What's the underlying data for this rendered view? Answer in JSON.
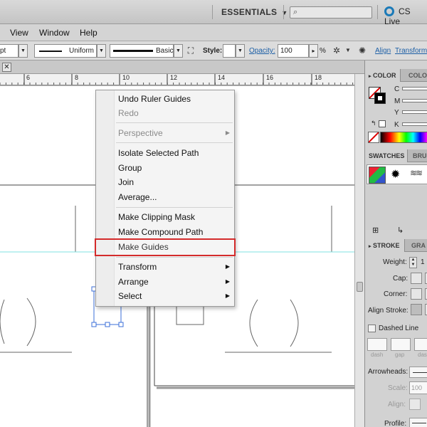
{
  "appbar": {
    "workspace": "ESSENTIALS",
    "cs_live": "CS Live"
  },
  "menu": [
    "View",
    "Window",
    "Help"
  ],
  "controlbar": {
    "stroke_unit": "pt",
    "profile_label": "Uniform",
    "brush_label": "Basic",
    "style_label": "Style:",
    "opacity_label": "Opacity:",
    "opacity_value": "100",
    "opacity_unit": "%",
    "align_label": "Align",
    "transform_label": "Transform"
  },
  "ruler": {
    "labels": [
      "6",
      "8",
      "10",
      "12",
      "14",
      "16",
      "18"
    ]
  },
  "context_menu": {
    "items": [
      {
        "label": "Undo Ruler Guides",
        "enabled": true,
        "submenu": false
      },
      {
        "label": "Redo",
        "enabled": false,
        "submenu": false
      },
      {
        "label": "Perspective",
        "enabled": false,
        "submenu": true
      },
      {
        "label": "Isolate Selected Path",
        "enabled": true,
        "submenu": false
      },
      {
        "label": "Group",
        "enabled": true,
        "submenu": false
      },
      {
        "label": "Join",
        "enabled": true,
        "submenu": false
      },
      {
        "label": "Average...",
        "enabled": true,
        "submenu": false
      },
      {
        "label": "Make Clipping Mask",
        "enabled": true,
        "submenu": false
      },
      {
        "label": "Make Compound Path",
        "enabled": true,
        "submenu": false
      },
      {
        "label": "Make Guides",
        "enabled": true,
        "submenu": false,
        "highlighted": true
      },
      {
        "label": "Transform",
        "enabled": true,
        "submenu": true
      },
      {
        "label": "Arrange",
        "enabled": true,
        "submenu": true
      },
      {
        "label": "Select",
        "enabled": true,
        "submenu": true
      }
    ]
  },
  "panels": {
    "color": {
      "tab": "COLOR",
      "tab2": "COLO",
      "channels": [
        "C",
        "M",
        "Y",
        "K"
      ]
    },
    "swatches": {
      "tab": "SWATCHES",
      "tab2": "BRUS"
    },
    "stroke": {
      "tab": "STROKE",
      "tab2": "GRA",
      "weight_label": "Weight:",
      "weight_value": "1",
      "cap_label": "Cap:",
      "corner_label": "Corner:",
      "align_label": "Align Stroke:",
      "dashed_label": "Dashed Line",
      "dash_labels": [
        "dash",
        "gap",
        "dash"
      ],
      "arrowheads_label": "Arrowheads:",
      "scale_label": "Scale:",
      "scale_value": "100",
      "align_label2": "Align:",
      "profile_label": "Profile:"
    }
  },
  "colors": {
    "accent_link": "#1c5fa6",
    "highlight_border": "#d42b2b",
    "guide": "#7fe0e0",
    "selection": "#3b6fd8"
  }
}
